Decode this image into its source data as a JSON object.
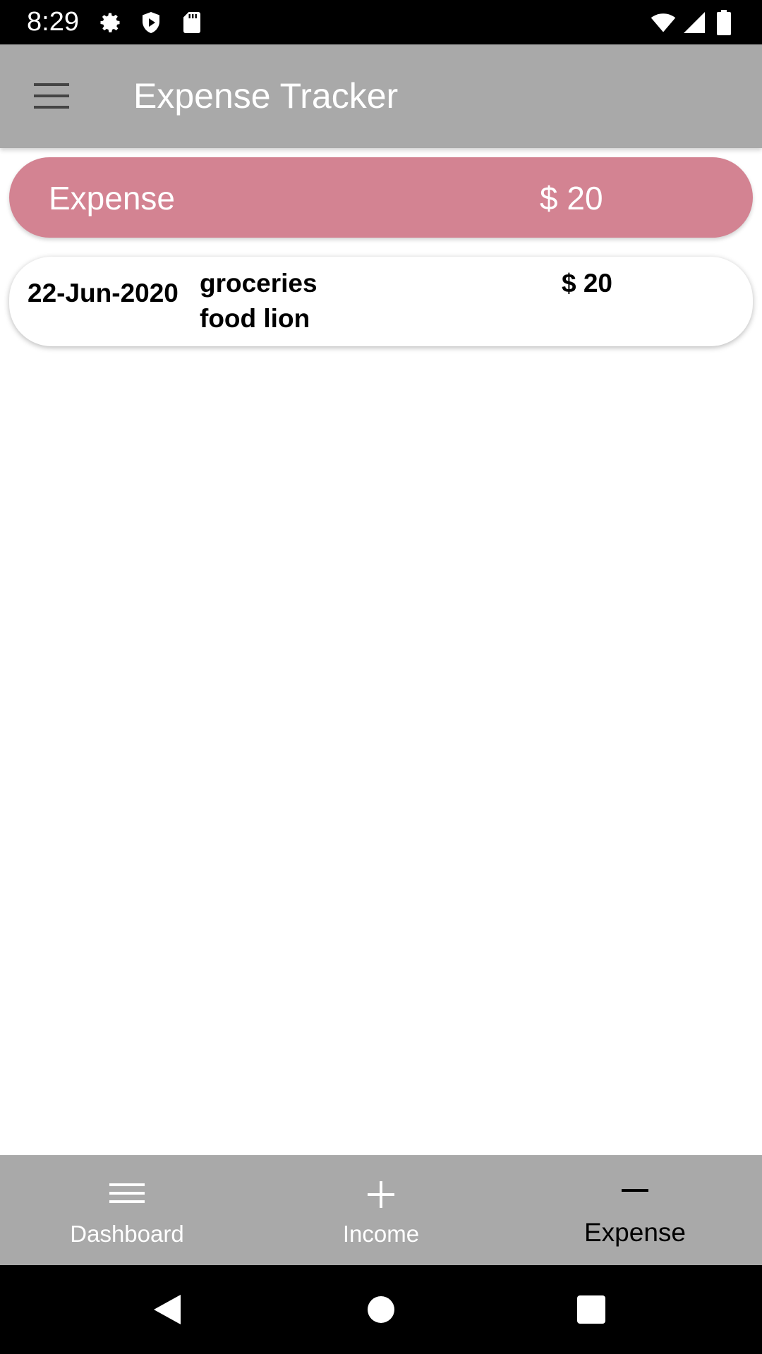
{
  "status_bar": {
    "time": "8:29",
    "left_icons": [
      "settings-gear-icon",
      "shield-play-icon",
      "sd-card-icon"
    ],
    "right_icons": [
      "wifi-icon",
      "cell-signal-icon",
      "battery-icon"
    ]
  },
  "app_bar": {
    "title": "Expense Tracker",
    "menu_icon": "hamburger-menu-icon"
  },
  "summary": {
    "label": "Expense",
    "amount": "$ 20"
  },
  "transactions": [
    {
      "date": "22-Jun-2020",
      "category": "groceries",
      "note": "food lion",
      "amount": "$ 20"
    }
  ],
  "bottom_nav": {
    "items": [
      {
        "label": "Dashboard",
        "icon": "list-icon",
        "active": false
      },
      {
        "label": "Income",
        "icon": "plus-icon",
        "active": false
      },
      {
        "label": "Expense",
        "icon": "minus-icon",
        "active": true
      }
    ]
  },
  "system_nav": {
    "buttons": [
      "back-icon",
      "home-icon",
      "recents-icon"
    ]
  },
  "colors": {
    "app_bar": "#a9a9a9",
    "summary_pill": "#d38392",
    "status_bar": "#000000",
    "active_nav_label": "#000000",
    "inactive_nav_label": "#ffffff"
  }
}
